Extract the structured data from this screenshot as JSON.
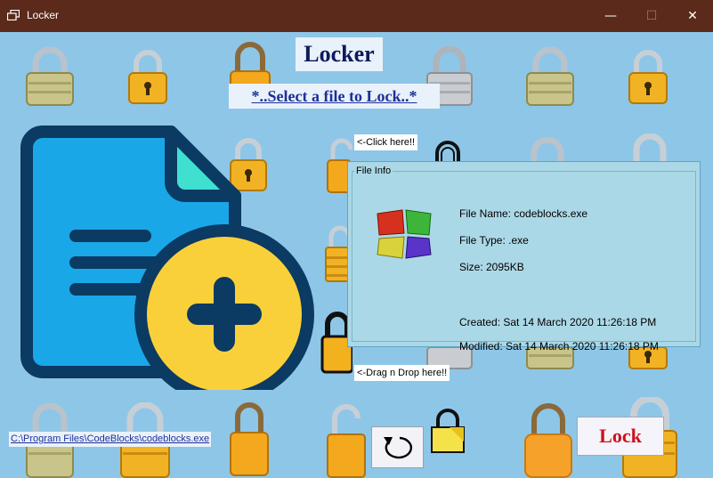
{
  "window": {
    "title": "Locker",
    "minimize_glyph": "—",
    "maximize_glyph": "☐",
    "close_glyph": "✕"
  },
  "header": {
    "title": "Locker",
    "select_link": "*..Select  a file to Lock..*"
  },
  "hints": {
    "click_here": "<-Click here!!",
    "drag_drop": "<-Drag n Drop here!!"
  },
  "file_info": {
    "legend": "File Info",
    "file_name": "File Name: codeblocks.exe",
    "file_type": "File Type: .exe",
    "size": "Size: 2095KB",
    "created": "Created: Sat 14 March 2020 11:26:18 PM",
    "modified": "Modified: Sat 14 March 2020 11:26:18 PM"
  },
  "file_path": "C:\\Program Files\\CodeBlocks\\codeblocks.exe",
  "buttons": {
    "lock_label": "Lock",
    "reset_icon": "refresh-icon"
  },
  "colors": {
    "titlebar": "#5b2a1a",
    "background": "#8ec6e8",
    "lock_button_text": "#d0101c",
    "heading_text": "#10195a",
    "link_text": "#1e2f9a"
  }
}
